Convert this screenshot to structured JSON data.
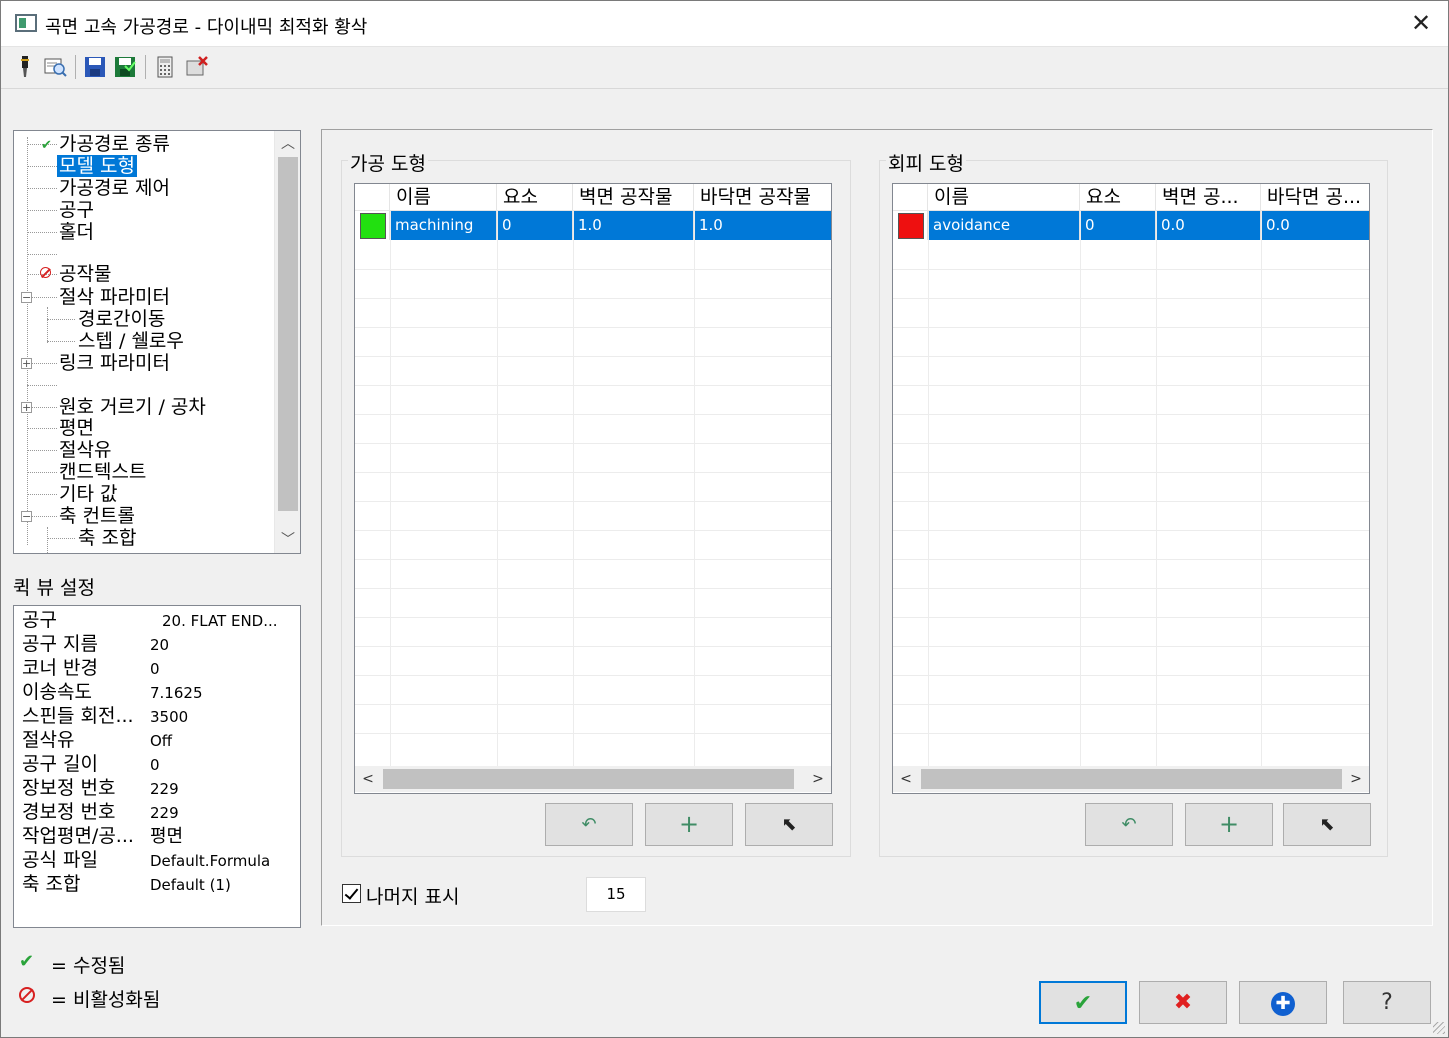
{
  "window": {
    "title": "곡면 고속 가공경로 - 다이내믹 최적화 황삭",
    "close_glyph": "✕"
  },
  "toolbar": {
    "icons": [
      "tool-icon",
      "preview-icon",
      "save-icon",
      "save-all-icon",
      "calculator-icon",
      "delete-icon"
    ]
  },
  "tree": {
    "items": [
      {
        "label": "가공경로 종류",
        "mark": "modified"
      },
      {
        "label": "모델 도형",
        "selected": true
      },
      {
        "label": "가공경로 제어"
      },
      {
        "label": "공구"
      },
      {
        "label": "홀더"
      },
      {
        "label": ""
      },
      {
        "label": "공작물",
        "mark": "disabled"
      },
      {
        "label": "절삭 파라미터",
        "expander": "−"
      },
      {
        "label": "경로간이동"
      },
      {
        "label": "스텝 / 쉘로우"
      },
      {
        "label": "링크 파라미터",
        "expander": "+"
      },
      {
        "label": ""
      },
      {
        "label": "원호 거르기 / 공차",
        "expander": "+"
      },
      {
        "label": "평면"
      },
      {
        "label": "절삭유"
      },
      {
        "label": "캔드텍스트"
      },
      {
        "label": "기타 값"
      },
      {
        "label": "축 컨트롤",
        "expander": "−"
      },
      {
        "label": "축 조합"
      }
    ],
    "scroll_up": "︿",
    "scroll_down": "﹀"
  },
  "quick_view": {
    "title": "퀵 뷰 설정",
    "rows": [
      {
        "key": "공구",
        "value": "20. FLAT END..."
      },
      {
        "key": "공구 지름",
        "value": "20"
      },
      {
        "key": "코너 반경",
        "value": "0"
      },
      {
        "key": "이송속도",
        "value": "7.1625"
      },
      {
        "key": "스핀들 회전...",
        "value": "3500"
      },
      {
        "key": "절삭유",
        "value": "Off"
      },
      {
        "key": "공구 길이",
        "value": "0"
      },
      {
        "key": "장보정 번호",
        "value": "229"
      },
      {
        "key": "경보정 번호",
        "value": "229"
      },
      {
        "key": "작업평면/공...",
        "value": "평면"
      },
      {
        "key": "공식 파일",
        "value": "Default.Formula"
      },
      {
        "key": "축 조합",
        "value": "Default (1)"
      }
    ]
  },
  "legend": {
    "modified": "= 수정됨",
    "disabled": "= 비활성화됨"
  },
  "machining_group": {
    "title": "가공 도형",
    "headers": [
      "",
      "이름",
      "요소",
      "벽면 공작물",
      "바닥면 공작물"
    ],
    "rows": [
      {
        "color": "#22e010",
        "name": "machining",
        "elements": "0",
        "wall": "1.0",
        "floor": "1.0"
      }
    ],
    "buttons": {
      "undo": "↶",
      "add": "+",
      "select": "⬉"
    }
  },
  "avoidance_group": {
    "title": "회피 도형",
    "headers": [
      "",
      "이름",
      "요소",
      "벽면 공...",
      "바닥면 공..."
    ],
    "rows": [
      {
        "color": "#ee1010",
        "name": "avoidance",
        "elements": "0",
        "wall": "0.0",
        "floor": "0.0"
      }
    ],
    "buttons": {
      "undo": "↶",
      "add": "+",
      "select": "⬉"
    }
  },
  "show_remaining": {
    "label": "나머지 표시",
    "checked": true,
    "value": "15"
  },
  "dialog_buttons": {
    "ok": "✔",
    "cancel": "✖",
    "apply": "✚",
    "help": "?"
  },
  "colors": {
    "selection": "#0078d7",
    "ok": "#2aa33a",
    "cancel": "#e02020",
    "apply": "#1060d0"
  }
}
